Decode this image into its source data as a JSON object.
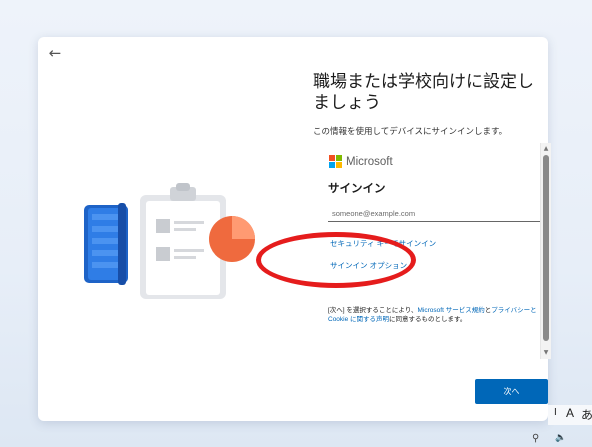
{
  "nav": {
    "back_glyph": "←"
  },
  "page": {
    "title": "職場または学校向けに設定しましょう",
    "subtitle": "この情報を使用してデバイスにサインインします。"
  },
  "signin_card": {
    "brand_name": "Microsoft",
    "brand_colors": [
      "#f25022",
      "#7fba00",
      "#00a4ef",
      "#ffb900"
    ],
    "heading": "サインイン",
    "email_placeholder": "someone@example.com",
    "security_key_link": "セキュリティ キーでサインイン",
    "signin_options_link": "サインイン オプション",
    "terms": {
      "part1": "[次へ] を選択することにより、",
      "link1": "Microsoft サービス規約",
      "part2": "と",
      "link2": "プライバシーと Cookie に関する声明",
      "part3": "に同意するものとします。"
    }
  },
  "actions": {
    "next_label": "次へ"
  },
  "taskbar": {
    "ime_mode": "A",
    "ime_indicator": "I",
    "ime_lang": "あ"
  },
  "icons": [
    "back-arrow-icon",
    "microsoft-logo-icon",
    "notebook-icon",
    "clipboard-icon",
    "pie-chart-icon",
    "accessibility-icon",
    "volume-icon"
  ],
  "colors": {
    "accent": "#0067b8",
    "highlight": "#e51c1c"
  }
}
